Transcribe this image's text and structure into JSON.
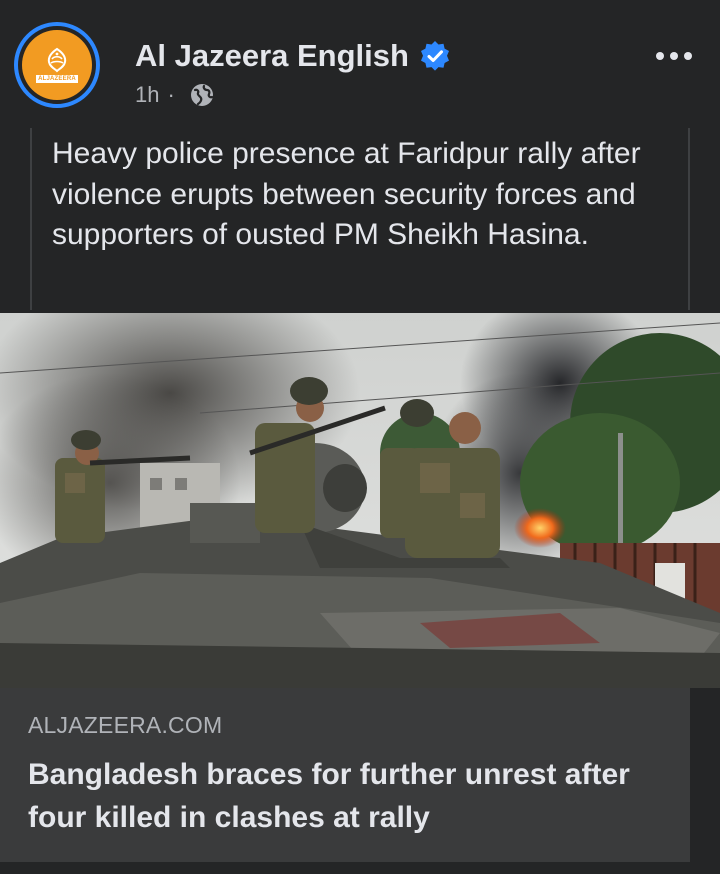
{
  "post": {
    "page_name": "Al Jazeera English",
    "avatar_text": "ALJAZEERA",
    "timestamp": "1h",
    "separator": "·",
    "privacy_icon": "globe-icon",
    "verified_icon": "verified-badge-icon",
    "more_icon": "more-options-icon",
    "message": "Heavy police presence at Faridpur rally after violence erupts between security forces and supporters of ousted PM Sheikh Hasina."
  },
  "link_preview": {
    "domain": "ALJAZEERA.COM",
    "title": "Bangladesh braces for further unrest after four killed in clashes at rally"
  },
  "colors": {
    "background": "#242526",
    "link_box": "#3a3b3c",
    "accent_blue": "#2d88ff",
    "brand_orange": "#f29b22",
    "primary_text": "#e4e6eb",
    "secondary_text": "#b0b3b8"
  }
}
